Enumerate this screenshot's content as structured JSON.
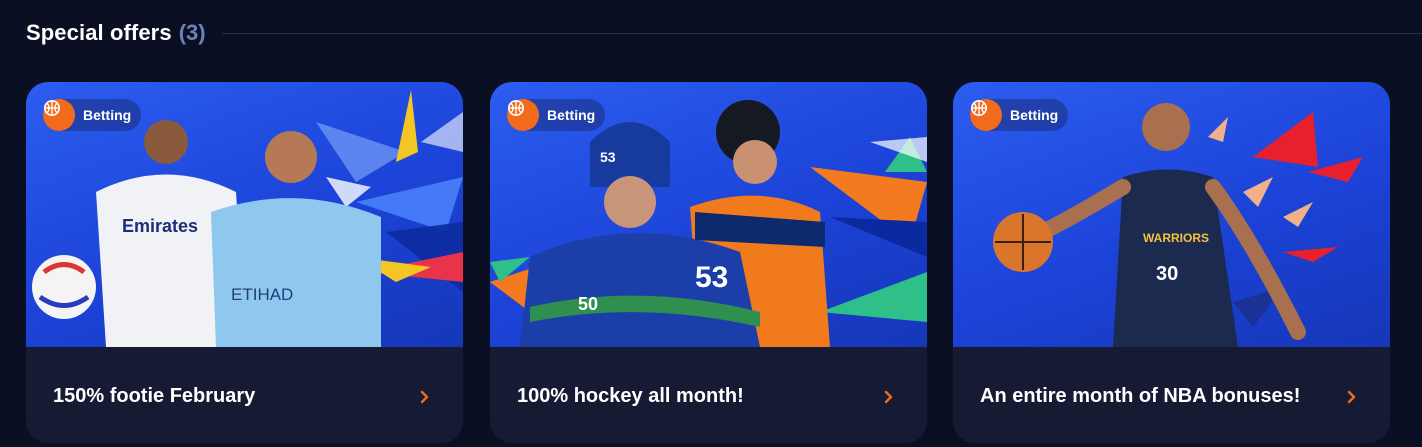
{
  "header": {
    "title": "Special offers",
    "count": "(3)"
  },
  "colors": {
    "accent": "#f26a1b",
    "background": "#0b0f24",
    "card": "#161b33",
    "banner": "#1f49e0"
  },
  "offers": [
    {
      "badge": "Betting",
      "badge_icon": "basketball-icon",
      "title": "150% footie February",
      "image": "football-players-banner"
    },
    {
      "badge": "Betting",
      "badge_icon": "basketball-icon",
      "title": "100% hockey all month!",
      "image": "hockey-players-banner"
    },
    {
      "badge": "Betting",
      "badge_icon": "basketball-icon",
      "title": "An entire month of NBA bonuses!",
      "image": "basketball-player-banner"
    }
  ]
}
